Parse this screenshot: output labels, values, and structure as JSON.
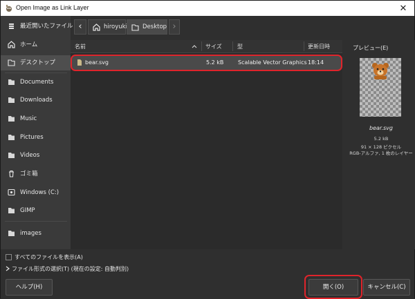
{
  "window": {
    "title": "Open Image as Link Layer",
    "close_glyph": "✕",
    "app_icon": "gimp-icon"
  },
  "sidebar": {
    "items": [
      {
        "label": "最近開いたファイル",
        "icon": "recent-icon"
      },
      {
        "label": "ホーム",
        "icon": "home-icon"
      },
      {
        "label": "デスクトップ",
        "icon": "folder-icon"
      },
      {
        "label": "Documents",
        "icon": "folder-icon"
      },
      {
        "label": "Downloads",
        "icon": "folder-icon"
      },
      {
        "label": "Music",
        "icon": "folder-icon"
      },
      {
        "label": "Pictures",
        "icon": "folder-icon"
      },
      {
        "label": "Videos",
        "icon": "folder-icon"
      },
      {
        "label": "ゴミ箱",
        "icon": "trash-icon"
      },
      {
        "label": "Windows (C:)",
        "icon": "drive-icon"
      },
      {
        "label": "GIMP",
        "icon": "folder-icon"
      },
      {
        "label": "images",
        "icon": "folder-icon"
      }
    ]
  },
  "pathbar": {
    "back_glyph": "‹",
    "forward_glyph": "›",
    "crumbs": [
      {
        "label": "hiroyuki",
        "icon": "home-icon"
      },
      {
        "label": "Desktop",
        "icon": "folder-icon"
      }
    ]
  },
  "filelist": {
    "columns": {
      "name": "名前",
      "size": "サイズ",
      "type": "型",
      "modified": "更新日時"
    },
    "rows": [
      {
        "name": "bear.svg",
        "size": "5.2 kB",
        "type": "Scalable Vector Graphics",
        "modified": "18:14"
      }
    ]
  },
  "preview": {
    "label": "プレビュー(E)",
    "filename": "bear.svg",
    "size": "5.2 kB",
    "dimensions": "91 × 128 ピクセル",
    "mode": "RGB-アルファ, 1 枚のレイヤー"
  },
  "options": {
    "show_all_files": "すべてのファイルを表示(A)",
    "file_type": "ファイル形式の選択(T) (現在の設定: 自動判別)"
  },
  "buttons": {
    "help": "ヘルプ(H)",
    "open": "開く(O)",
    "cancel": "キャンセル(C)"
  },
  "colors": {
    "highlight": "#e0242b",
    "selected_row": "#4a4a4a",
    "sidebar_selected": "#4e4e4e"
  }
}
